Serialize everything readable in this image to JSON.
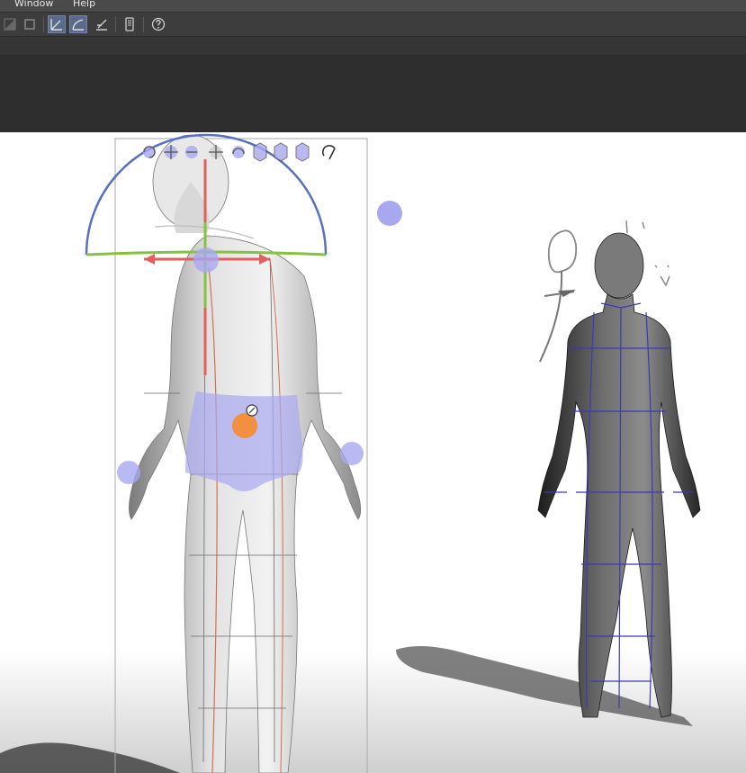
{
  "menu": {
    "items": [
      "Window",
      "Help"
    ]
  },
  "toolbar": {
    "colors": {
      "bg": "#3d3d3d",
      "selected": "#5a6a8a",
      "icon": "#c9c9c9"
    },
    "buttons": [
      {
        "name": "layer-icon",
        "selected": false
      },
      {
        "name": "frame-icon",
        "selected": false
      },
      {
        "name": "ruler-straight-icon",
        "selected": true
      },
      {
        "name": "ruler-curve-icon",
        "selected": true
      },
      {
        "name": "ruler-edit-icon",
        "selected": false
      },
      {
        "name": "device-icon",
        "selected": false
      },
      {
        "name": "help-icon",
        "selected": false
      }
    ]
  },
  "viewport": {
    "manipulator_icons": [
      "rotate-camera-icon",
      "pan-camera-icon",
      "zoom-camera-icon",
      "move-3d-icon",
      "rotate-3d-icon",
      "rotate-axis-icon",
      "scale-3d-icon",
      "reset-pose-icon",
      "flip-pose-icon"
    ],
    "colors": {
      "x_axis": "#e06060",
      "y_axis": "#88c040",
      "z_arc": "#5870c0",
      "joint": "#a8a8f0",
      "selected_joint": "#f09040",
      "selection_fill": "#a8a8f0",
      "grid_line_left": "#6a6a6a",
      "grid_line_right": "#3b3bb0"
    }
  }
}
